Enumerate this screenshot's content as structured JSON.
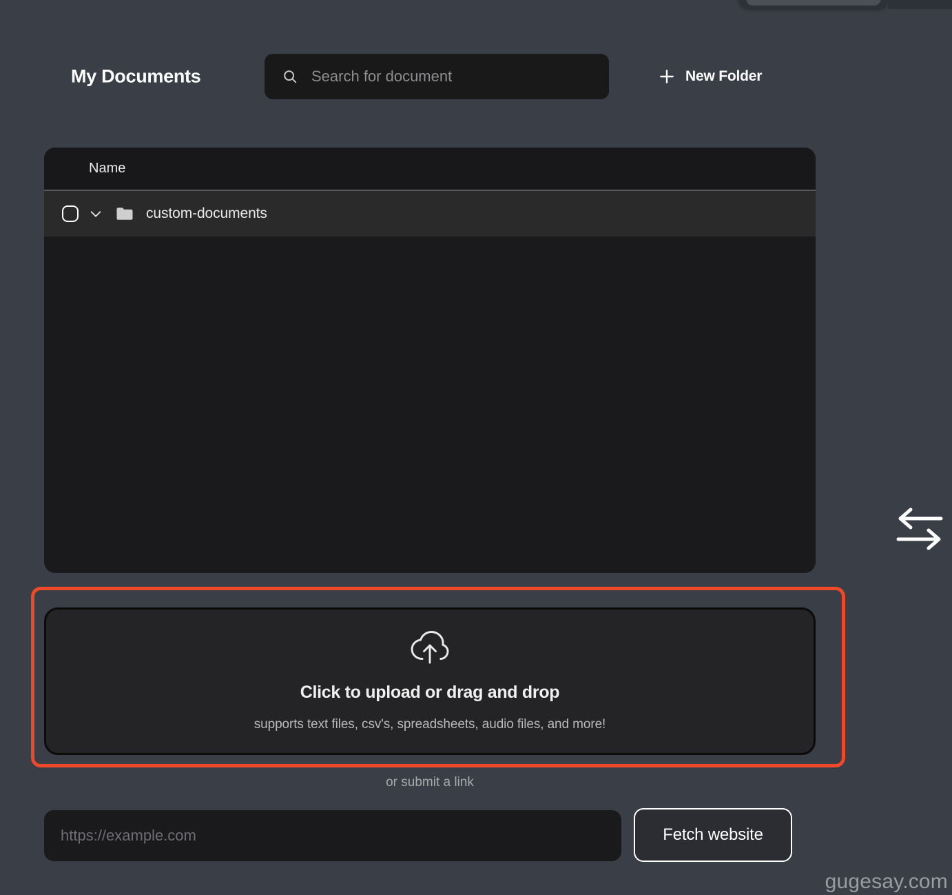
{
  "header": {
    "title": "My Documents",
    "search": {
      "placeholder": "Search for document",
      "value": "",
      "icon": "search-icon"
    },
    "new_folder": {
      "label": "New Folder",
      "icon": "plus-icon"
    }
  },
  "file_panel": {
    "columns": [
      "Name"
    ],
    "rows": [
      {
        "name": "custom-documents",
        "type": "folder",
        "checked": false,
        "expanded": false,
        "checkbox_icon": "checkbox-unchecked-icon",
        "chevron_icon": "chevron-down-icon",
        "type_icon": "folder-icon"
      }
    ]
  },
  "side_controls": {
    "transfer_icon": "transfer-arrows-icon"
  },
  "upload": {
    "title": "Click to upload or drag and drop",
    "subtitle": "supports text files, csv's, spreadsheets, audio files, and more!",
    "icon": "cloud-upload-icon",
    "highlight_color": "#f0492a"
  },
  "submit_link": {
    "divider_label": "or submit a link",
    "url_placeholder": "https://example.com",
    "url_value": "",
    "fetch_label": "Fetch website"
  },
  "watermark": {
    "text": "gugesay.com"
  }
}
